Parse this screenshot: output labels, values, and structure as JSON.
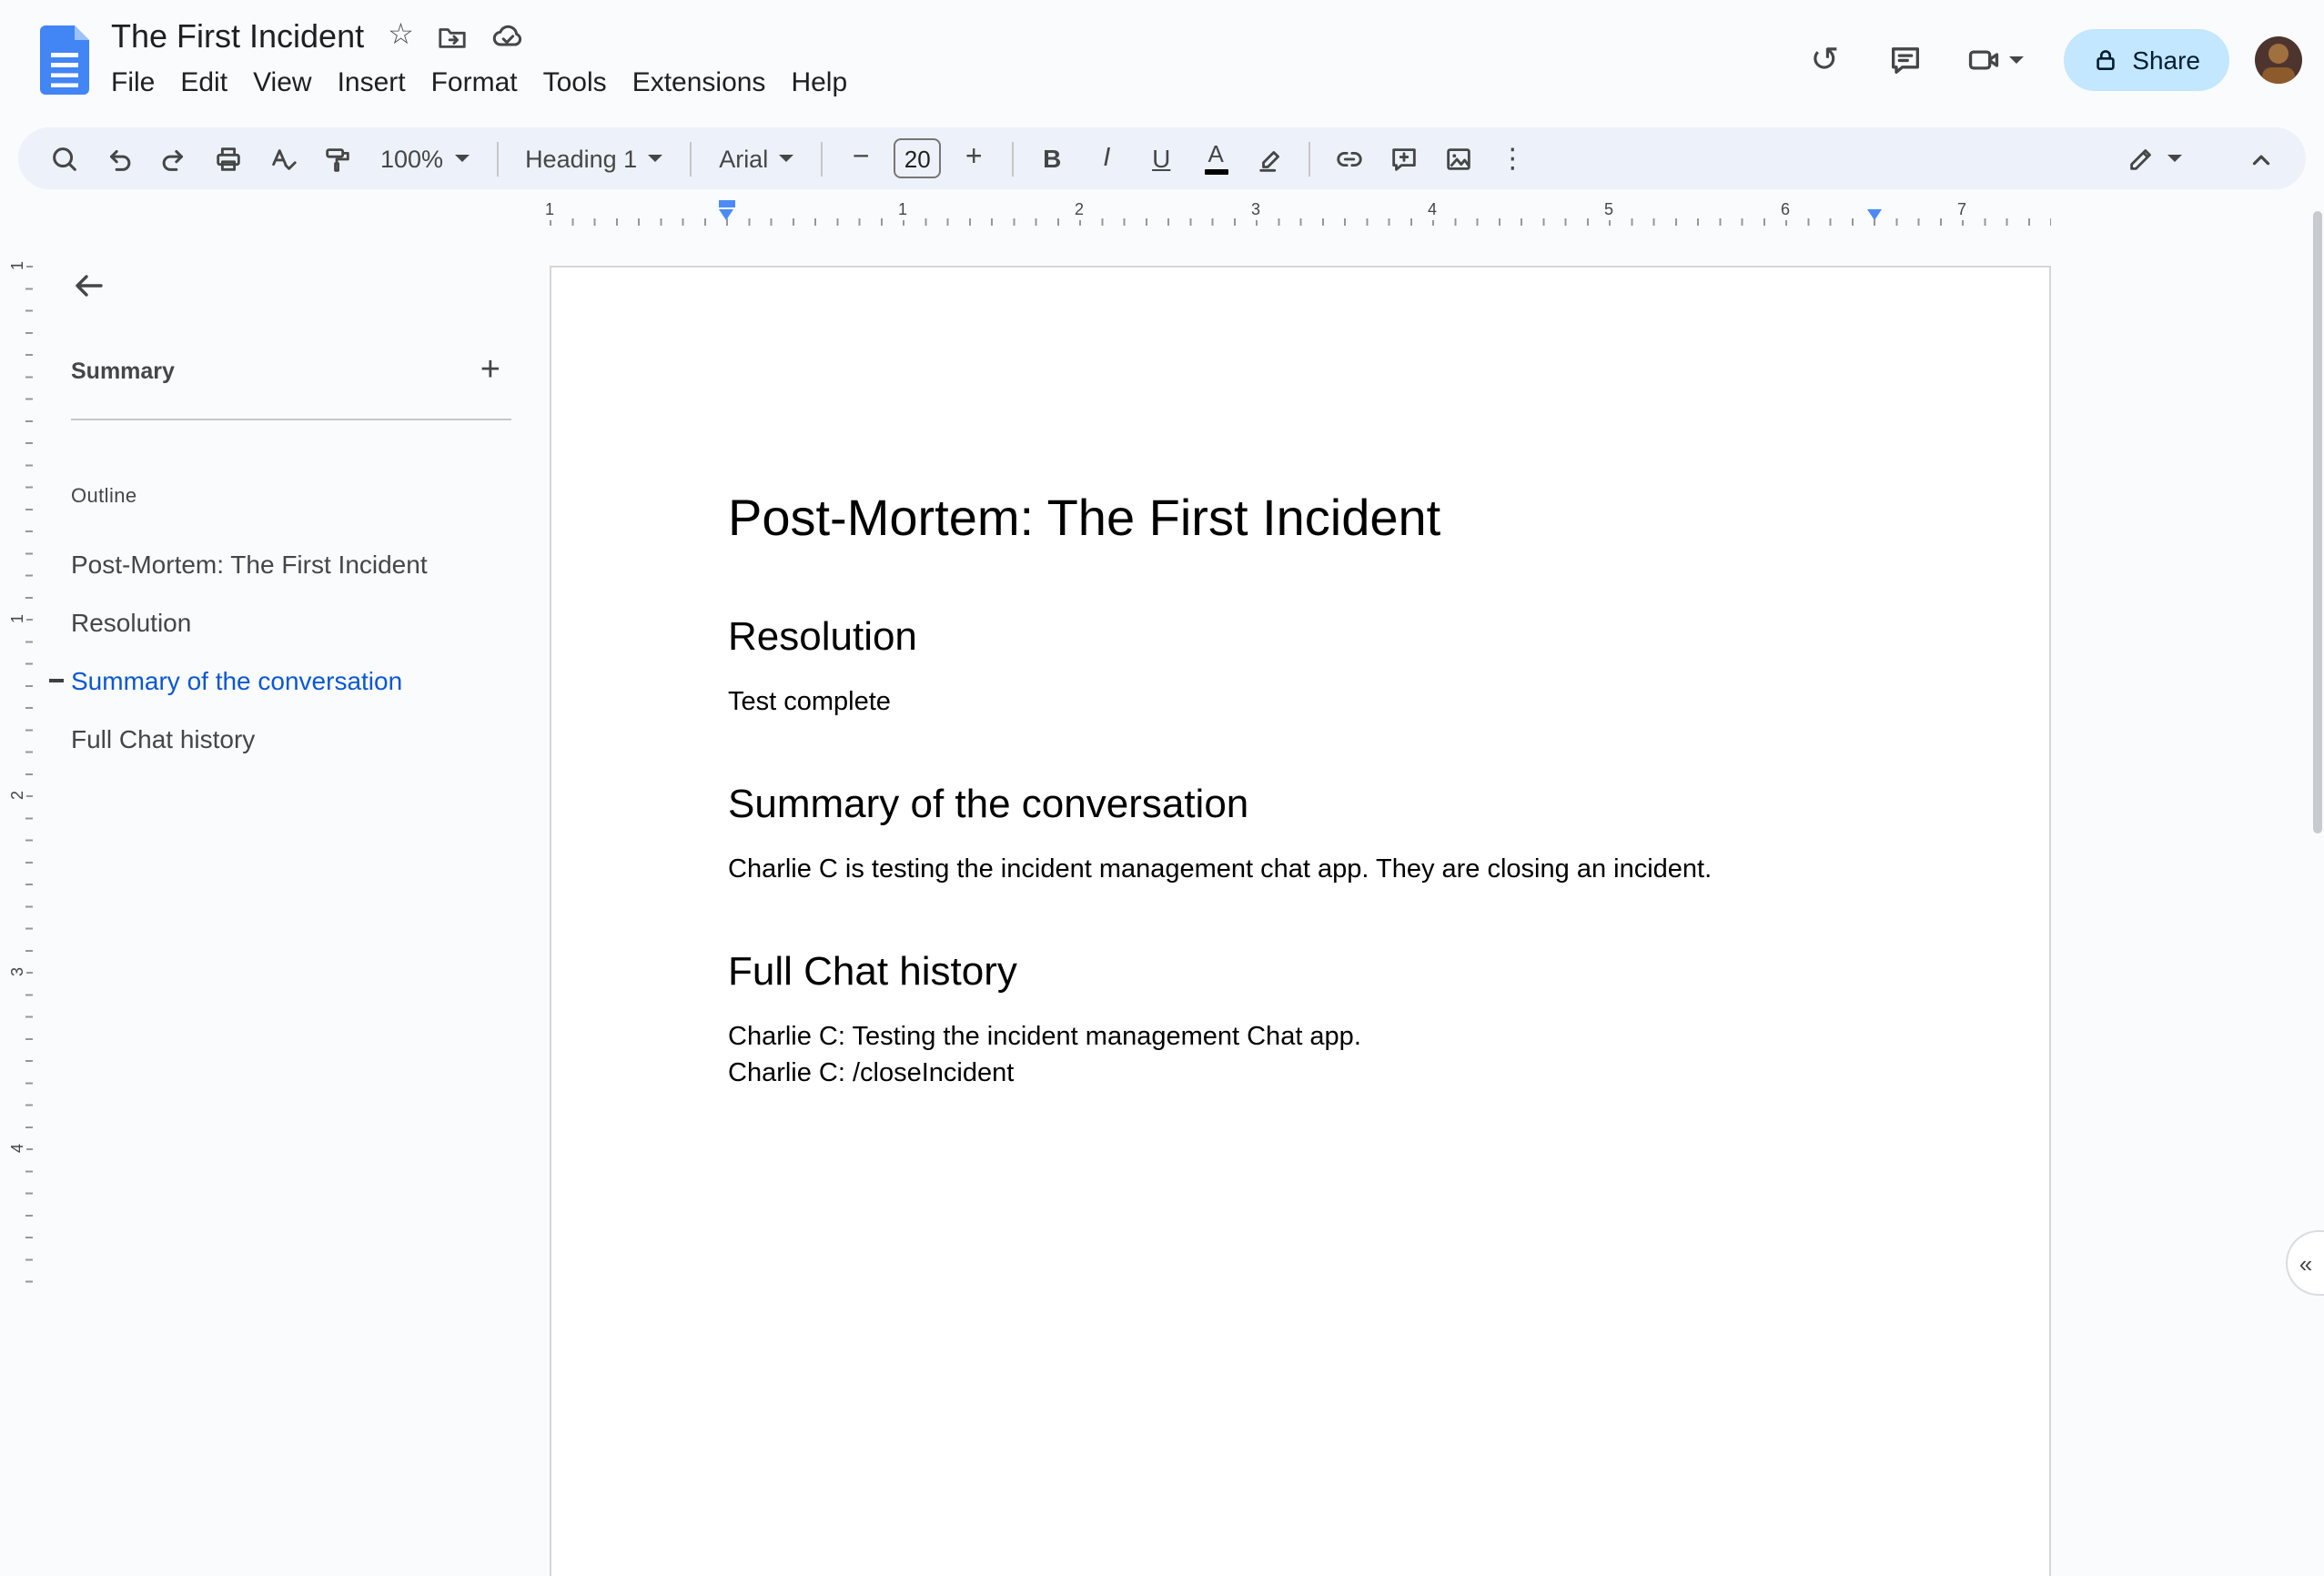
{
  "header": {
    "title": "The First Incident",
    "menus": [
      "File",
      "Edit",
      "View",
      "Insert",
      "Format",
      "Tools",
      "Extensions",
      "Help"
    ],
    "share": {
      "label": "Share"
    }
  },
  "toolbar": {
    "zoom": "100%",
    "style": "Heading 1",
    "font": "Arial",
    "font_size": "20",
    "bold": "B",
    "italic": "I",
    "underline": "U",
    "text_color": "A"
  },
  "icons": {
    "star": "☆",
    "history": "↺",
    "plus": "+",
    "minus": "−",
    "more": "⋮",
    "collapse": "«"
  },
  "ruler": {
    "horizontal": [
      "1",
      "1",
      "2",
      "3",
      "4",
      "5",
      "6",
      "7"
    ],
    "vertical": [
      "1",
      "1",
      "2",
      "3",
      "4"
    ]
  },
  "sidebar": {
    "summary_label": "Summary",
    "outline_label": "Outline",
    "items": [
      {
        "label": "Post-Mortem: The First Incident",
        "active": false
      },
      {
        "label": "Resolution",
        "active": false
      },
      {
        "label": "Summary of the conversation",
        "active": true
      },
      {
        "label": "Full Chat history",
        "active": false
      }
    ]
  },
  "document": {
    "title": "Post-Mortem: The First Incident",
    "sections": [
      {
        "heading": "Resolution",
        "paragraphs": [
          "Test complete"
        ]
      },
      {
        "heading": "Summary of the conversation",
        "paragraphs": [
          "Charlie C is testing the incident management chat app. They are closing an incident."
        ]
      },
      {
        "heading": "Full Chat history",
        "paragraphs": [
          "Charlie C: Testing the incident management Chat app.",
          "Charlie C: /closeIncident"
        ]
      }
    ]
  },
  "colors": {
    "docs_blue": "#4285f4",
    "toolbar_bg": "#edf2fa",
    "canvas_bg": "#f9fbfd",
    "share_bg": "#c2e7ff",
    "share_text": "#001d35",
    "outline_active": "#0b57d0",
    "icon": "#444746",
    "ruler_marker": "#4c8bf5"
  }
}
